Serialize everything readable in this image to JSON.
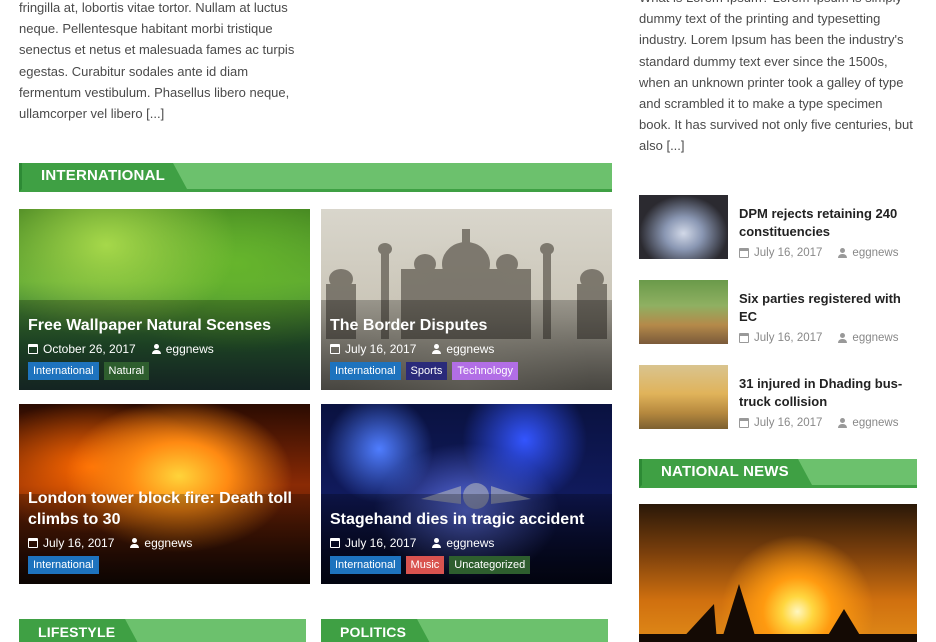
{
  "left_excerpt": "fringilla at, lobortis vitae tortor. Nullam at luctus neque. Pellentesque habitant morbi tristique senectus et netus et malesuada fames ac turpis egestas. Curabitur sodales ante id diam fermentum vestibulum. Phasellus libero neque, ullamcorper vel libero [...]",
  "right_excerpt": "What is Lorem Ipsum? Lorem Ipsum is simply dummy text of the printing and typesetting industry. Lorem Ipsum has been the industry's standard dummy text ever since the 1500s, when an unknown printer took a galley of type and scrambled it to make a type specimen book. It has survived not only five centuries, but also [...]",
  "sections": {
    "international": "INTERNATIONAL",
    "national": "NATIONAL NEWS",
    "lifestyle": "LIFESTYLE",
    "politics": "POLITICS"
  },
  "cards": [
    {
      "title": "Free Wallpaper Natural Scenses",
      "date": "October 26, 2017",
      "author": "eggnews",
      "tags": [
        {
          "label": "International",
          "color": "#1e73be"
        },
        {
          "label": "Natural",
          "color": "#2e5e2e"
        }
      ]
    },
    {
      "title": "The Border Disputes",
      "date": "July 16, 2017",
      "author": "eggnews",
      "tags": [
        {
          "label": "International",
          "color": "#1e73be"
        },
        {
          "label": "Sports",
          "color": "#2a2a7a"
        },
        {
          "label": "Technology",
          "color": "#b26ee6"
        }
      ]
    },
    {
      "title": "London tower block fire: Death toll climbs to 30",
      "date": "July 16, 2017",
      "author": "eggnews",
      "tags": [
        {
          "label": "International",
          "color": "#1e73be"
        }
      ]
    },
    {
      "title": "Stagehand dies in tragic accident",
      "date": "July 16, 2017",
      "author": "eggnews",
      "tags": [
        {
          "label": "International",
          "color": "#1e73be"
        },
        {
          "label": "Music",
          "color": "#d9534f"
        },
        {
          "label": "Uncategorized",
          "color": "#2e5e2e"
        }
      ]
    }
  ],
  "side_posts": [
    {
      "title": "DPM rejects retaining 240 constituencies",
      "date": "July 16, 2017",
      "author": "eggnews"
    },
    {
      "title": "Six parties registered with EC",
      "date": "July 16, 2017",
      "author": "eggnews"
    },
    {
      "title": "31 injured in Dhading bus-truck collision",
      "date": "July 16, 2017",
      "author": "eggnews"
    }
  ],
  "colors": {
    "accent": "#6cc16d",
    "accent_dark": "#3fa044"
  }
}
